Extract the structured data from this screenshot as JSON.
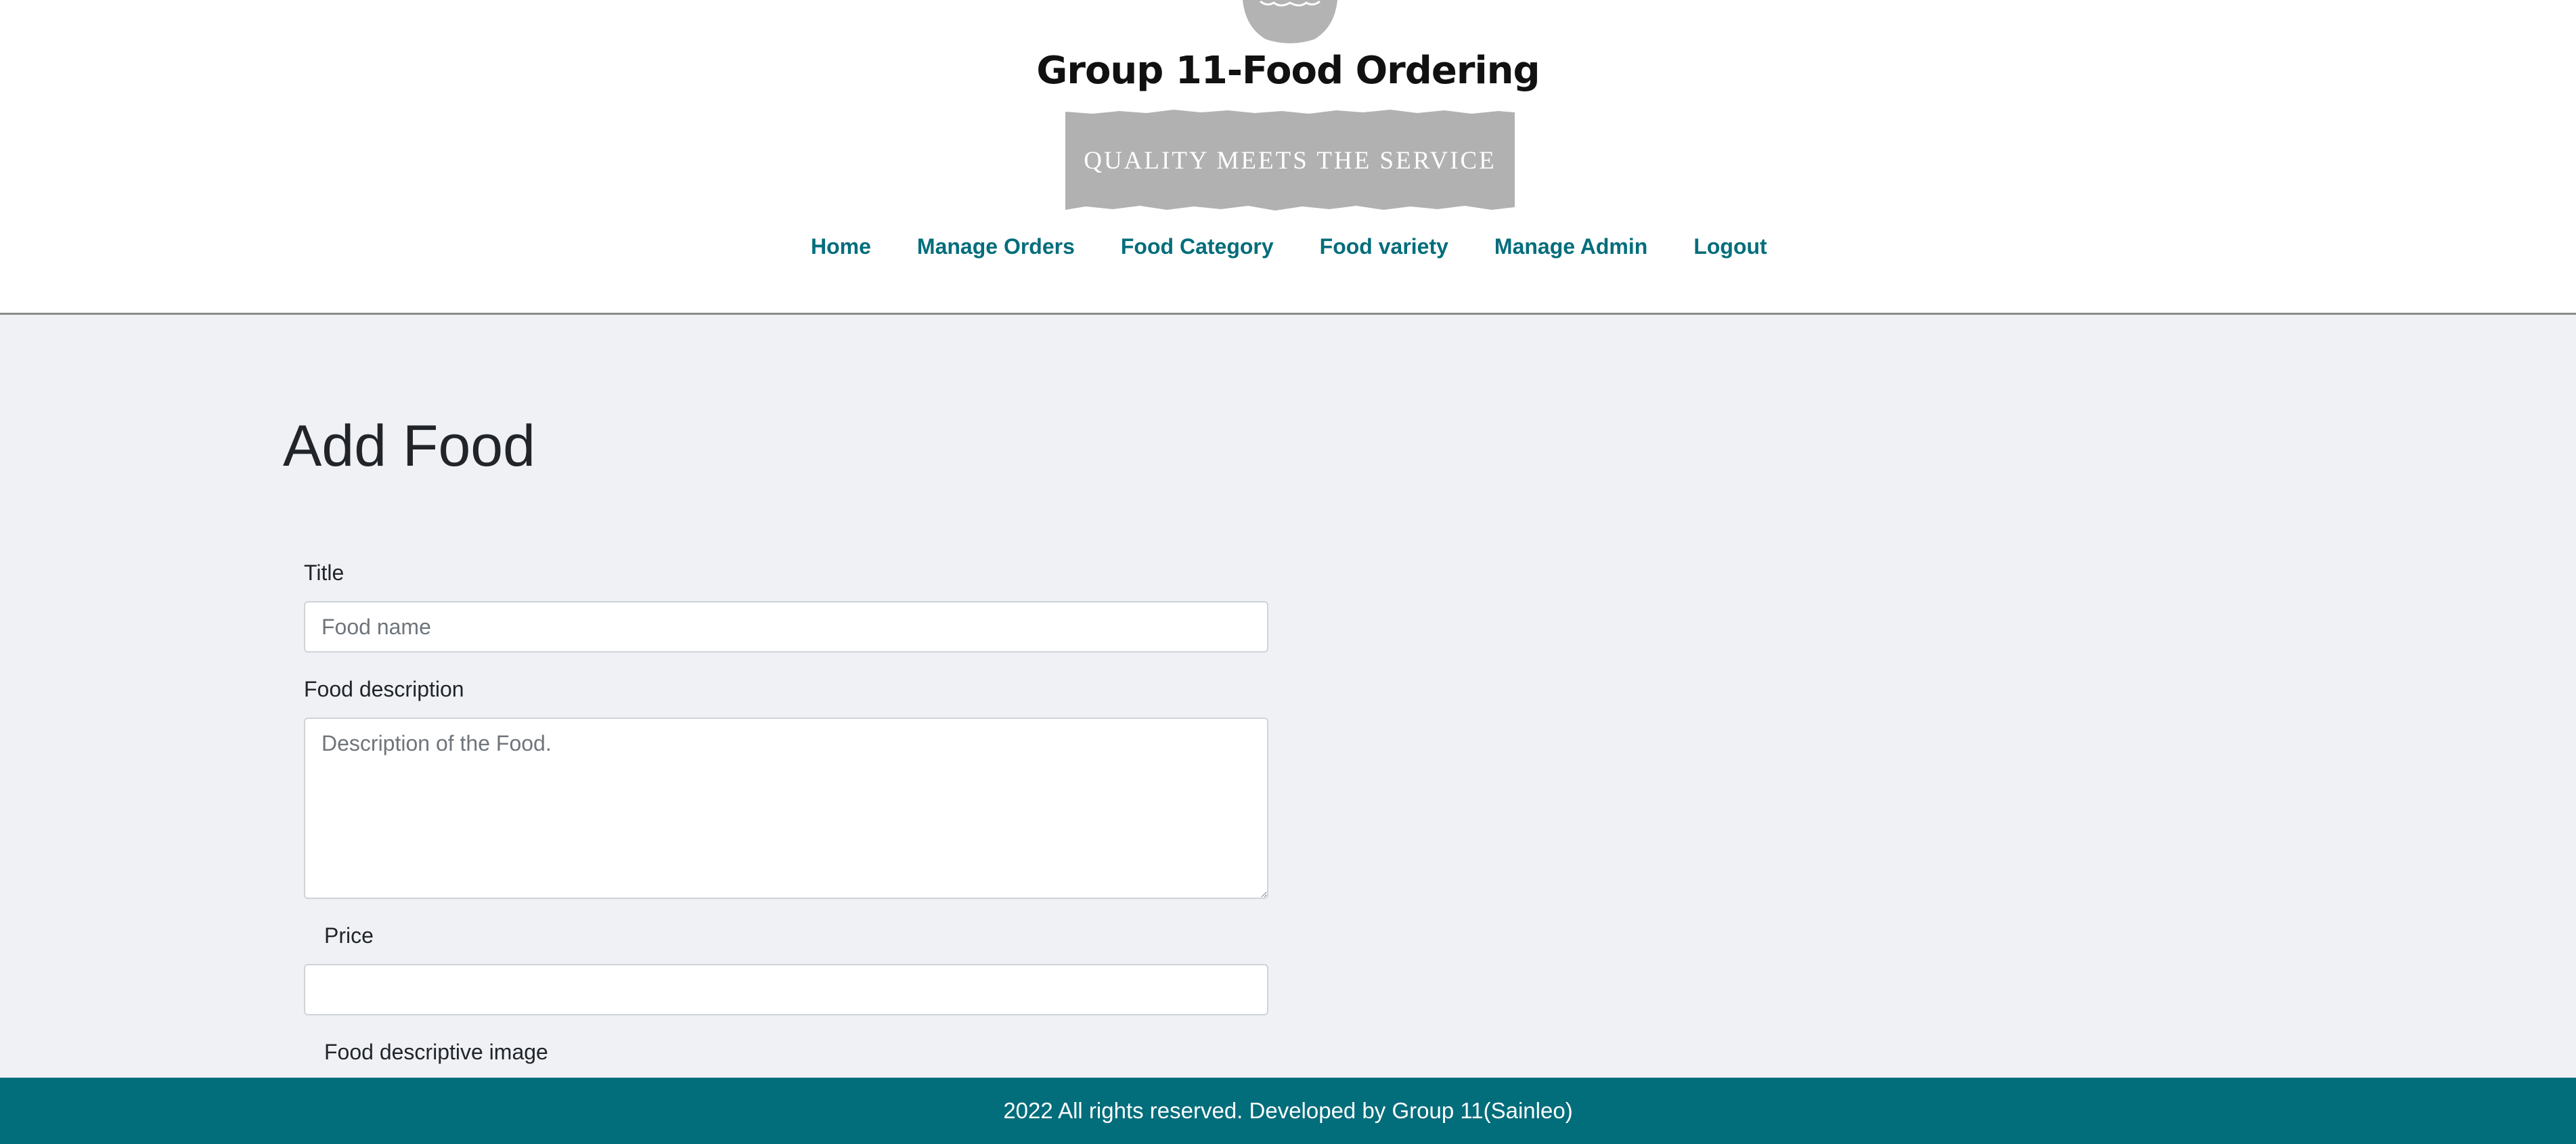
{
  "header": {
    "site_title": "Group 11-Food Ordering",
    "banner_text": "Quality meets the service",
    "logo_icon": "bowl-logo-icon"
  },
  "nav": {
    "items": [
      {
        "label": "Home"
      },
      {
        "label": "Manage Orders"
      },
      {
        "label": "Food Category"
      },
      {
        "label": "Food variety"
      },
      {
        "label": "Manage Admin"
      },
      {
        "label": "Logout"
      }
    ]
  },
  "main": {
    "page_title": "Add Food",
    "form": {
      "title_label": "Title",
      "title_placeholder": "Food name",
      "title_value": "",
      "description_label": "Food description",
      "description_placeholder": "Description of the Food.",
      "description_value": "",
      "price_label": "Price",
      "price_value": "",
      "image_label": "Food descriptive image"
    }
  },
  "footer": {
    "text": "2022 All rights reserved. Developed by Group 11(Sainleo)"
  },
  "colors": {
    "accent": "#026d7b",
    "page_background": "#eff1f5",
    "banner": "#b1b1b1"
  }
}
